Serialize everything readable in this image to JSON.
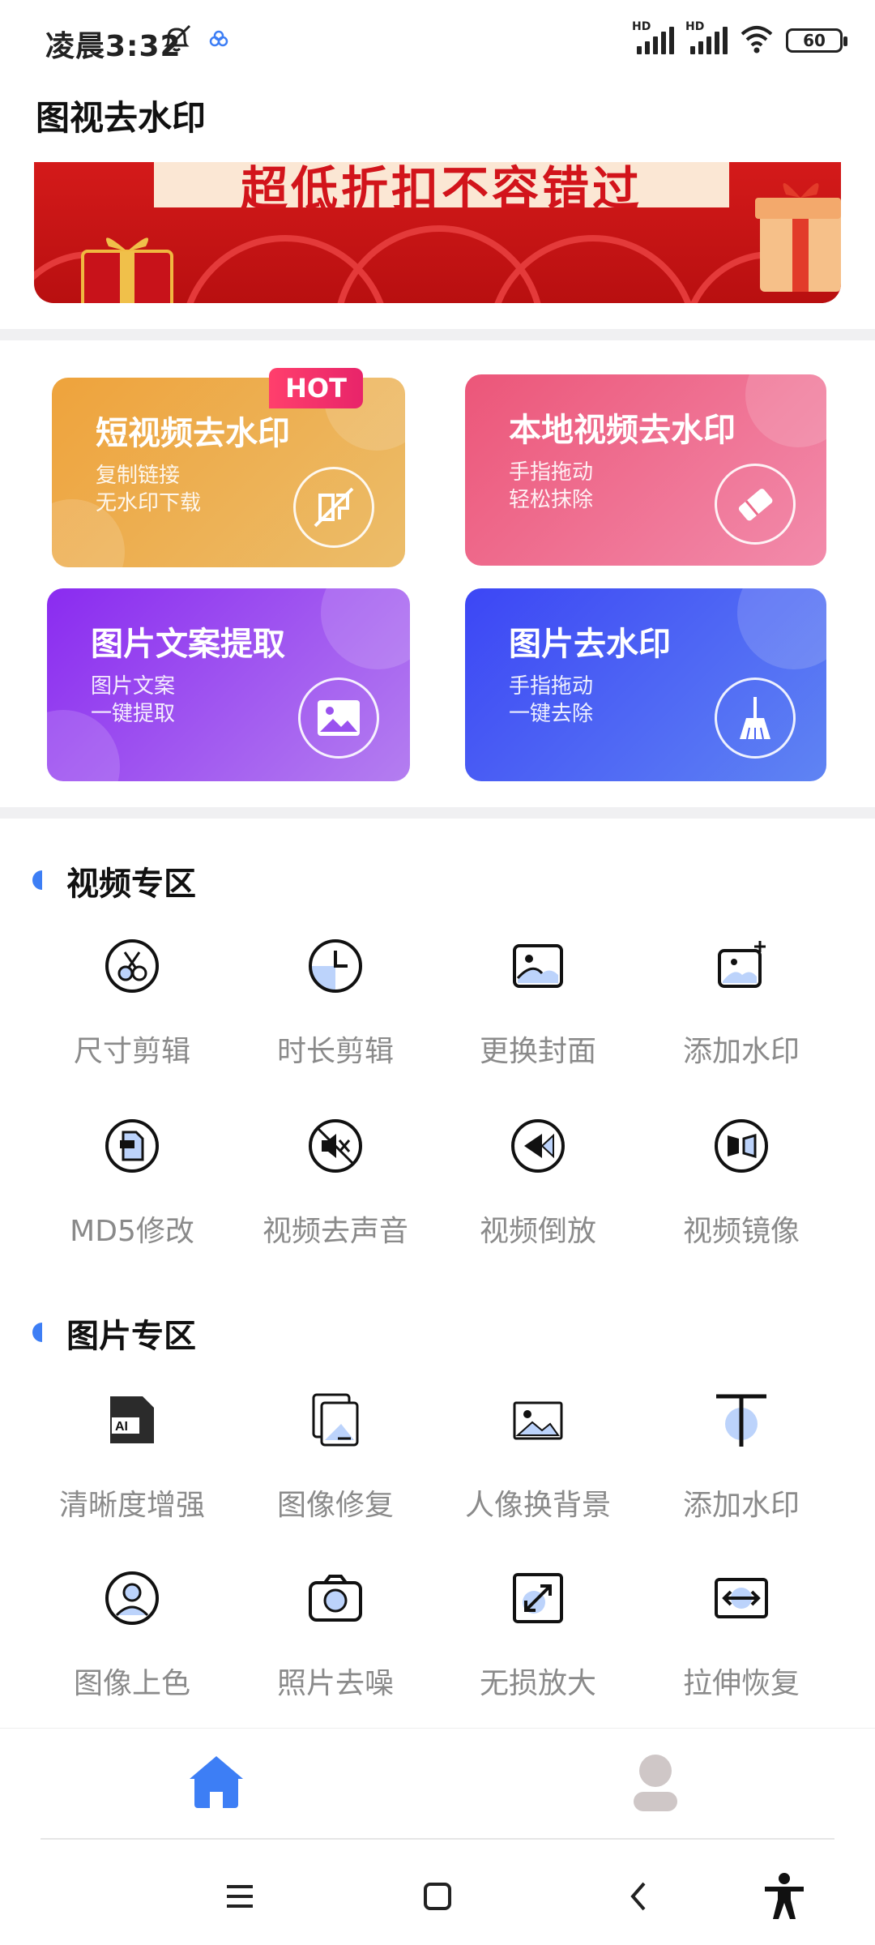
{
  "status_bar": {
    "time": "凌晨3:32",
    "signal1_label": "HD",
    "signal2_label": "HD",
    "battery": "60"
  },
  "app": {
    "title": "图视去水印"
  },
  "banner": {
    "text": "超低折扣不容错过"
  },
  "feature_cards": [
    {
      "title": "短视频去水印",
      "desc1": "复制链接",
      "desc2": "无水印下载",
      "badge": "HOT",
      "icon": "no-watermark-icon",
      "color_from": "#eea33c",
      "color_to": "#ecbd6a"
    },
    {
      "title": "本地视频去水印",
      "desc1": "手指拖动",
      "desc2": "轻松抹除",
      "icon": "eraser-icon",
      "color_from": "#ec5679",
      "color_to": "#f28bab"
    },
    {
      "title": "图片文案提取",
      "desc1": "图片文案",
      "desc2": "一键提取",
      "icon": "image-icon",
      "color_from": "#8a2bf0",
      "color_to": "#b47ef0"
    },
    {
      "title": "图片去水印",
      "desc1": "手指拖动",
      "desc2": "一键去除",
      "icon": "broom-icon",
      "color_from": "#3c46f5",
      "color_to": "#5f84f3"
    }
  ],
  "video_section": {
    "title": "视频专区",
    "tools": [
      {
        "label": "尺寸剪辑",
        "icon": "scissors-icon"
      },
      {
        "label": "时长剪辑",
        "icon": "clock-icon"
      },
      {
        "label": "更换封面",
        "icon": "cover-icon"
      },
      {
        "label": "添加水印",
        "icon": "add-image-icon"
      },
      {
        "label": "MD5修改",
        "icon": "md5-icon"
      },
      {
        "label": "视频去声音",
        "icon": "mute-icon"
      },
      {
        "label": "视频倒放",
        "icon": "rewind-icon"
      },
      {
        "label": "视频镜像",
        "icon": "mirror-icon"
      }
    ]
  },
  "image_section": {
    "title": "图片专区",
    "tools": [
      {
        "label": "清晰度增强",
        "icon": "ai-icon",
        "icon_text": "AI"
      },
      {
        "label": "图像修复",
        "icon": "repair-icon"
      },
      {
        "label": "人像换背景",
        "icon": "background-icon"
      },
      {
        "label": "添加水印",
        "icon": "text-watermark-icon"
      },
      {
        "label": "图像上色",
        "icon": "colorize-icon"
      },
      {
        "label": "照片去噪",
        "icon": "camera-icon"
      },
      {
        "label": "无损放大",
        "icon": "enlarge-icon"
      },
      {
        "label": "拉伸恢复",
        "icon": "stretch-icon"
      }
    ]
  },
  "bottom_nav": [
    {
      "name": "home",
      "icon": "home-icon",
      "active": true,
      "color": "#3d7ef5"
    },
    {
      "name": "profile",
      "icon": "user-icon",
      "active": false,
      "color": "#cfc7c7"
    }
  ]
}
